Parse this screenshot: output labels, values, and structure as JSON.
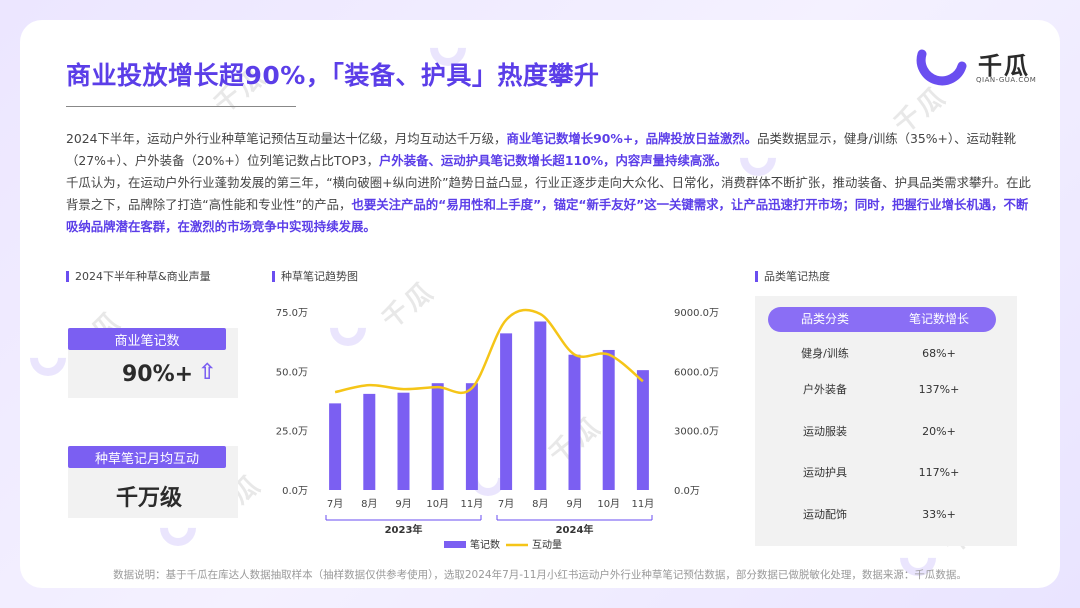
{
  "title": "商业投放增长超90%，「装备、护具」热度攀升",
  "logo": {
    "name": "千瓜",
    "sub": "QIAN-GUA.COM"
  },
  "intro": {
    "p1_a": "2024下半年，运动户外行业种草笔记预估互动量达十亿级，月均互动达千万级，",
    "p1_b": "商业笔记数增长90%+，品牌投放日益激烈。",
    "p1_c": "品类数据显示，健身/训练（35%+）、运动鞋靴（27%+）、户外装备（20%+）位列笔记数占比TOP3，",
    "p1_d": "户外装备、运动护具笔记数增长超110%，内容声量持续高涨。",
    "p2_a": "千瓜认为，在运动户外行业蓬勃发展的第三年，“横向破圈+纵向进阶”趋势日益凸显，行业正逐步走向大众化、日常化，消费群体不断扩张，推动装备、护具品类需求攀升。在此背景之下，品牌除了打造“高性能和专业性”的产品，",
    "p2_b": "也要关注产品的“易用性和上手度”，锚定“新手友好”这一关键需求，让产品迅速打开市场；同时，把握行业增长机遇，不断吸纳品牌潜在客群，在激烈的市场竞争中实现持续发展。"
  },
  "left_section": {
    "heading": "2024下半年种草&商业声量",
    "stat1": {
      "label": "商业笔记数",
      "value": "90%+"
    },
    "stat2": {
      "label": "种草笔记月均互动",
      "value": "千万级"
    }
  },
  "chart_section": {
    "heading": "种草笔记趋势图"
  },
  "chart_data": {
    "type": "bar",
    "categories": [
      "7月",
      "8月",
      "9月",
      "10月",
      "11月",
      "7月",
      "8月",
      "9月",
      "10月",
      "11月"
    ],
    "groups": [
      {
        "label": "2023年",
        "from": 0,
        "to": 4
      },
      {
        "label": "2024年",
        "from": 5,
        "to": 9
      }
    ],
    "series": [
      {
        "name": "笔记数",
        "type": "bar",
        "axis": "left",
        "color": "#7b5ff2",
        "values": [
          36.5,
          40.5,
          41,
          45,
          45,
          66,
          71,
          57,
          59,
          50.5
        ]
      },
      {
        "name": "互动量",
        "type": "line",
        "axis": "right",
        "color": "#f5c518",
        "values": [
          4950,
          5300,
          5100,
          5200,
          5150,
          8600,
          8900,
          6850,
          6850,
          5500
        ]
      }
    ],
    "y_left": {
      "min": 0,
      "max": 75,
      "ticks": [
        "0.0万",
        "25.0万",
        "50.0万",
        "75.0万"
      ]
    },
    "y_right": {
      "min": 0,
      "max": 9000,
      "ticks": [
        "0.0万",
        "3000.0万",
        "6000.0万",
        "9000.0万"
      ]
    },
    "legend_position": "bottom",
    "grid": false
  },
  "table_section": {
    "heading": "品类笔记热度",
    "headers": [
      "品类分类",
      "笔记数增长"
    ],
    "rows": [
      [
        "健身/训练",
        "68%+"
      ],
      [
        "户外装备",
        "137%+"
      ],
      [
        "运动服装",
        "20%+"
      ],
      [
        "运动护具",
        "117%+"
      ],
      [
        "运动配饰",
        "33%+"
      ]
    ]
  },
  "footnote": "数据说明：基于千瓜在库达人数据抽取样本（抽样数据仅供参考使用），选取2024年7月-11月小红书运动户外行业种草笔记预估数据，部分数据已做脱敏化处理，数据来源：千瓜数据。",
  "watermark": "千瓜",
  "colors": {
    "accent": "#5b3ee8",
    "bar": "#7b5ff2",
    "line": "#f5c518"
  },
  "icons": {
    "stat_arrow": "arrow-up-icon",
    "logo": "qiangua-logo-icon"
  }
}
